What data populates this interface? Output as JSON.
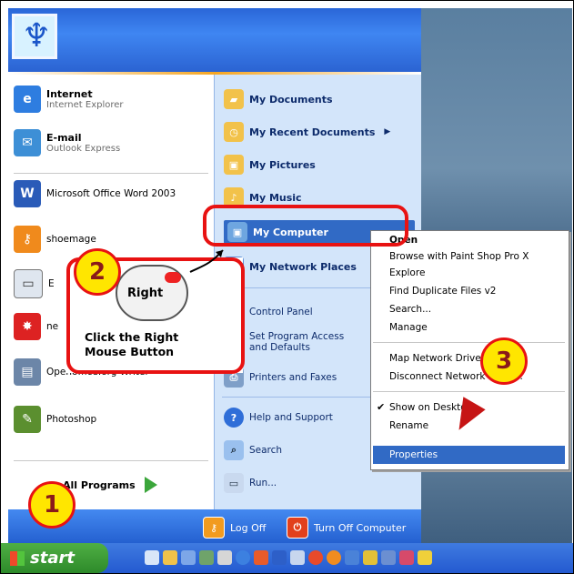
{
  "start_menu": {
    "pinned": [
      {
        "title": "Internet",
        "subtitle": "Internet Explorer"
      },
      {
        "title": "E-mail",
        "subtitle": "Outlook Express"
      }
    ],
    "recent": [
      {
        "label": "Microsoft Office Word 2003"
      },
      {
        "label": "shoemage"
      },
      {
        "label": "E"
      },
      {
        "label": "ne"
      },
      {
        "label": "Openoffice.org Writer"
      },
      {
        "label": "Photoshop"
      }
    ],
    "all_programs": "All Programs",
    "right": [
      {
        "label": "My Documents"
      },
      {
        "label": "My Recent Documents"
      },
      {
        "label": "My Pictures"
      },
      {
        "label": "My Music"
      },
      {
        "label": "My Computer"
      },
      {
        "label": "My Network Places"
      },
      {
        "label": "Control Panel"
      },
      {
        "label": "Set Program Access and Defaults"
      },
      {
        "label": "Printers and Faxes"
      },
      {
        "label": "Help and Support"
      },
      {
        "label": "Search"
      },
      {
        "label": "Run..."
      }
    ],
    "log_off": "Log Off",
    "turn_off": "Turn Off Computer"
  },
  "taskbar": {
    "start_label": "start"
  },
  "context_menu": {
    "items": [
      "Open",
      "Browse with Paint Shop Pro X",
      "Explore",
      "Find Duplicate Files v2",
      "Search...",
      "Manage",
      "Map Network Drive...",
      "Disconnect Network Drive...",
      "Show on Desktop",
      "Rename",
      "Properties"
    ]
  },
  "annotations": {
    "step1": "1",
    "step2": "2",
    "step3": "3",
    "mouse_label": "Right",
    "instruction_line1": "Click the Right",
    "instruction_line2": "Mouse Button"
  },
  "colors": {
    "highlight": "#316ac5",
    "annotation_red": "#e81212",
    "badge_yellow": "#ffe600"
  }
}
